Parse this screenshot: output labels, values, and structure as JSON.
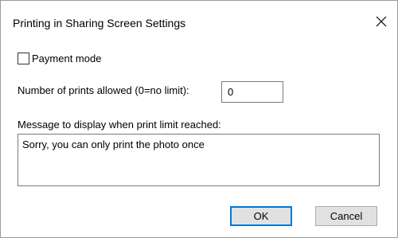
{
  "dialog": {
    "title": "Printing in Sharing Screen Settings",
    "close_icon": "close-icon"
  },
  "payment_mode": {
    "label": "Payment mode",
    "checked": false
  },
  "prints_allowed": {
    "label": "Number of prints allowed (0=no limit):",
    "value": "0"
  },
  "limit_message": {
    "label": "Message to display when print limit reached:",
    "value": "Sorry, you can only print the photo once"
  },
  "buttons": {
    "ok_label": "OK",
    "cancel_label": "Cancel"
  },
  "colors": {
    "accent": "#0078d7",
    "button_face": "#e1e1e1"
  }
}
